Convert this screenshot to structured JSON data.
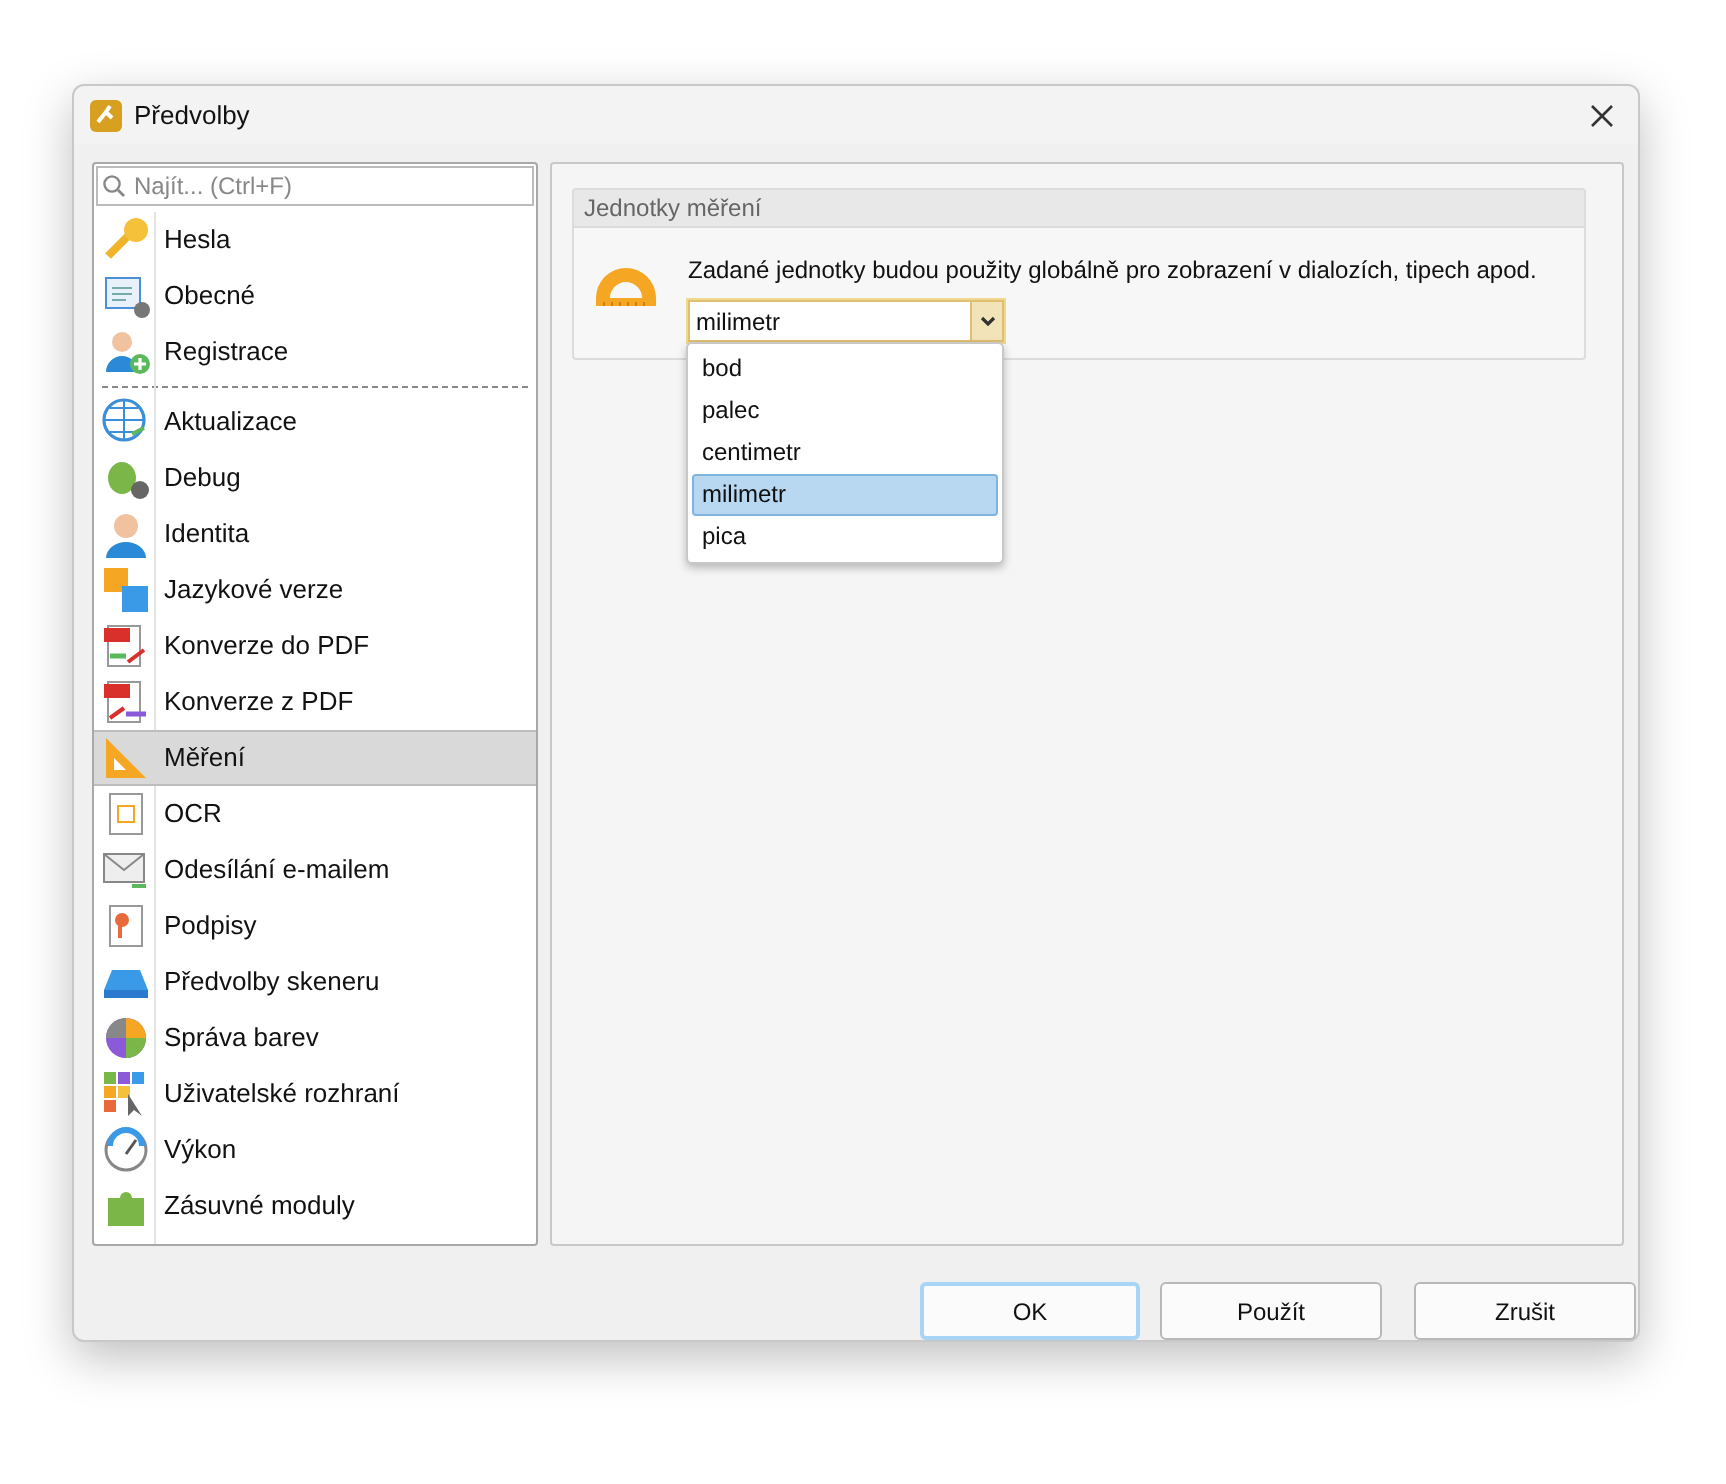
{
  "window": {
    "title": "Předvolby"
  },
  "sidebar": {
    "search": {
      "placeholder": "Najít... (Ctrl+F)"
    },
    "groups": [
      {
        "items": [
          {
            "label": "Hesla",
            "selected": false
          },
          {
            "label": "Obecné",
            "selected": false
          },
          {
            "label": "Registrace",
            "selected": false
          }
        ]
      },
      {
        "items": [
          {
            "label": "Aktualizace",
            "selected": false
          },
          {
            "label": "Debug",
            "selected": false
          },
          {
            "label": "Identita",
            "selected": false
          },
          {
            "label": "Jazykové verze",
            "selected": false
          },
          {
            "label": "Konverze do PDF",
            "selected": false
          },
          {
            "label": "Konverze z PDF",
            "selected": false
          },
          {
            "label": "Měření",
            "selected": true
          },
          {
            "label": "OCR",
            "selected": false
          },
          {
            "label": "Odesílání e-mailem",
            "selected": false
          },
          {
            "label": "Podpisy",
            "selected": false
          },
          {
            "label": "Předvolby skeneru",
            "selected": false
          },
          {
            "label": "Správa barev",
            "selected": false
          },
          {
            "label": "Uživatelské rozhraní",
            "selected": false
          },
          {
            "label": "Výkon",
            "selected": false
          },
          {
            "label": "Zásuvné moduly",
            "selected": false
          }
        ]
      }
    ]
  },
  "group": {
    "title": "Jednotky měření",
    "description": "Zadané jednotky budou použity globálně pro zobrazení v dialozích, tipech apod.",
    "combo": {
      "value": "milimetr",
      "expanded": true,
      "options": [
        {
          "label": "bod",
          "selected": false
        },
        {
          "label": "palec",
          "selected": false
        },
        {
          "label": "centimetr",
          "selected": false
        },
        {
          "label": "milimetr",
          "selected": true
        },
        {
          "label": "pica",
          "selected": false
        }
      ]
    }
  },
  "buttons": [
    {
      "label": "OK",
      "default": true
    },
    {
      "label": "Použít",
      "default": false
    },
    {
      "label": "Zrušit",
      "default": false
    }
  ]
}
